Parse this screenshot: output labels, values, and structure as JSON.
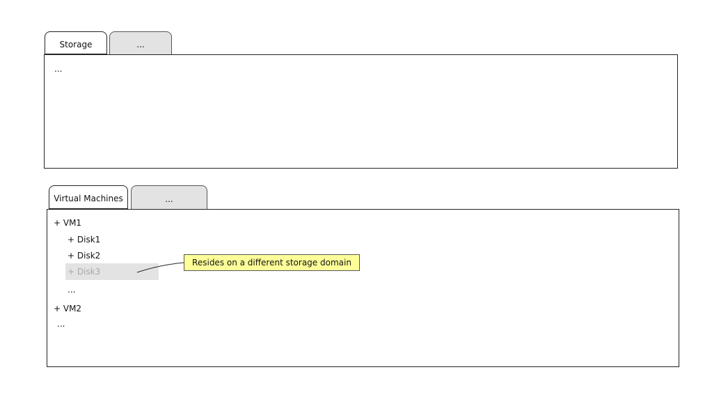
{
  "storage_section": {
    "tabs": [
      {
        "label": "Storage"
      },
      {
        "label": "..."
      }
    ],
    "panel_text": "..."
  },
  "vm_section": {
    "tabs": [
      {
        "label": "Virtual Machines"
      },
      {
        "label": "..."
      }
    ],
    "tree": {
      "vm1": "+ VM1",
      "disk1": "+ Disk1",
      "disk2": "+ Disk2",
      "disk3": "+ Disk3",
      "disk_more": "...",
      "vm2": "+ VM2",
      "vm_more": "..."
    },
    "callout": "Resides on a different storage domain"
  },
  "colors": {
    "inactive_tab": "#e3e3e3",
    "selected_row": "#e3e3e3",
    "callout_bg": "#ffff99",
    "muted_text": "#a8a8a8"
  }
}
